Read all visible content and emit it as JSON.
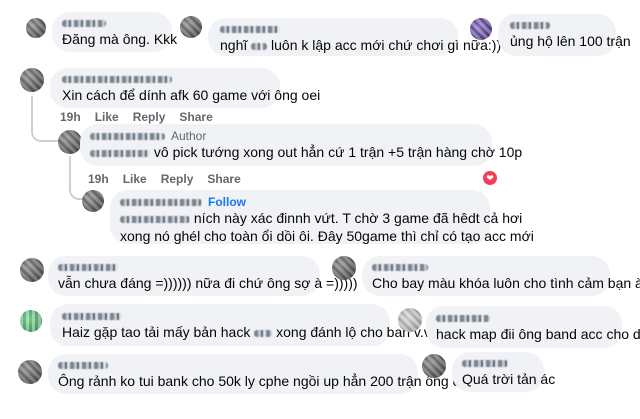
{
  "comments": [
    {
      "id": "c1",
      "text": "Đăng mà ông. Kkk"
    },
    {
      "id": "c2",
      "text_a": "nghĩ",
      "text_b": "luôn k lập acc mới chứ chơi gì nữa:))"
    },
    {
      "id": "c3",
      "text": "ủng hộ lên 100 trận"
    },
    {
      "id": "c4",
      "text": "Xin cách để dính afk 60 game với ông oei"
    },
    {
      "id": "c5",
      "author_tag": "Author",
      "text": "vô pick tướng xong out hẳn cứ 1 trận +5 trận hàng chờ 10p"
    },
    {
      "id": "c6",
      "follow_tag": "Follow",
      "line1": "ních này xác đinnh vứt. T chờ 3 game đã hêdt cả hơi",
      "line2": "xong nó ghél cho toàn ổi dồi ôi. Đây 50game thì chỉ có tạo acc mới"
    },
    {
      "id": "c7",
      "text": "vẫn chưa đáng =)))))) nữa đi chứ ông sợ à =)))))"
    },
    {
      "id": "c8",
      "text": "Cho bay màu khóa luôn cho tình cảm bạn à"
    },
    {
      "id": "c9",
      "text_a": "Haiz gặp tao tải mấy bản hack",
      "text_b": "xong đánh lộ cho ban v.v ;:))"
    },
    {
      "id": "c10",
      "text": "hack map đii ông band acc cho dui"
    },
    {
      "id": "c11",
      "text": "Ông rảnh ko tui bank cho 50k ly cphe ngồi up hẳn 200 trận ông ơi"
    },
    {
      "id": "c12",
      "text": "Quá trời tản ác"
    }
  ],
  "actions": {
    "time": "19h",
    "like": "Like",
    "reply": "Reply",
    "share": "Share"
  },
  "reaction": {
    "type": "heart-icon",
    "color": "#f33e58"
  }
}
